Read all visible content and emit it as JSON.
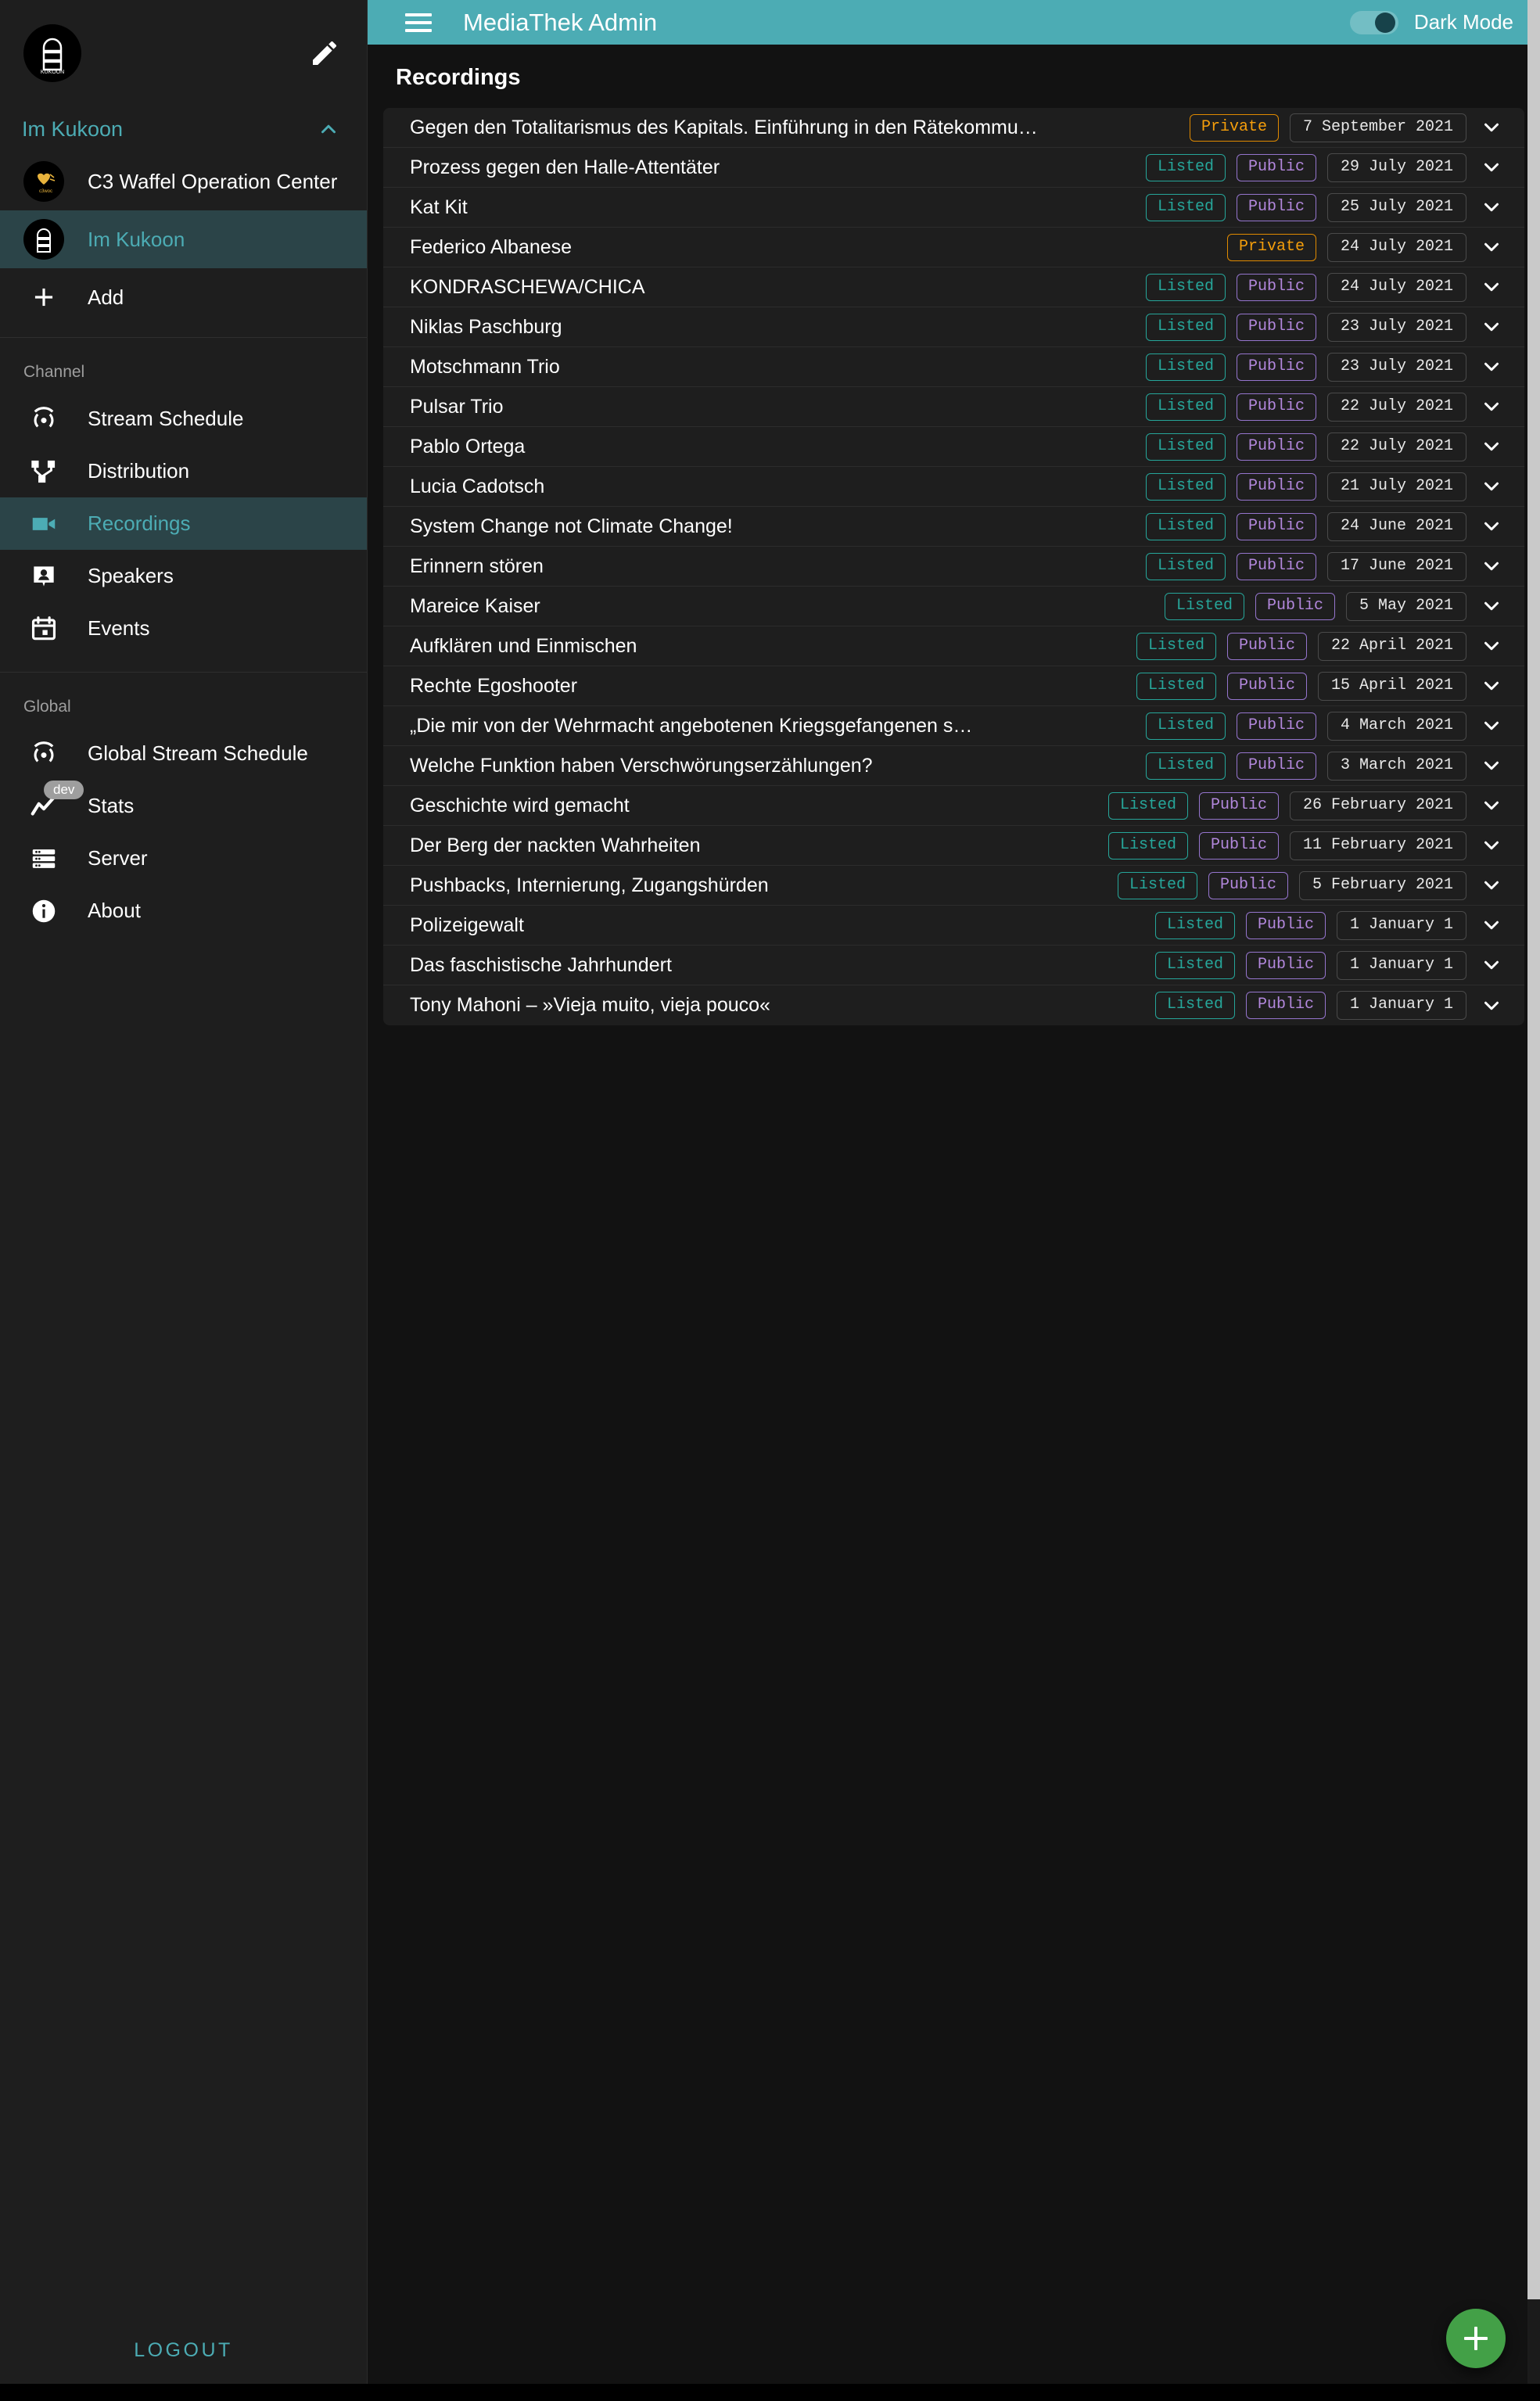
{
  "appbar": {
    "menu_icon": "hamburger-menu-icon",
    "title": "MediaThek Admin",
    "dark_mode_label": "Dark Mode",
    "dark_mode_on": true,
    "accent_color": "#4cacb4"
  },
  "sidebar": {
    "brand": {
      "logo_alt": "Im Kukoon logo",
      "edit_icon": "pencil-icon"
    },
    "workspace": {
      "name": "Im Kukoon",
      "collapse_icon": "chevron-up-icon"
    },
    "workspaces": [
      {
        "label": "C3 Waffel Operation Center",
        "avatar": "c3woc-waffle-heart-icon",
        "active": false
      },
      {
        "label": "Im Kukoon",
        "avatar": "kukoon-logo-icon",
        "active": true
      }
    ],
    "add": {
      "label": "Add",
      "icon": "plus-icon"
    },
    "sections": [
      {
        "label": "Channel",
        "items": [
          {
            "label": "Stream Schedule",
            "icon": "broadcast-icon",
            "active": false,
            "badge": ""
          },
          {
            "label": "Distribution",
            "icon": "distribution-fork-icon",
            "active": false,
            "badge": ""
          },
          {
            "label": "Recordings",
            "icon": "video-camera-icon",
            "active": true,
            "badge": ""
          },
          {
            "label": "Speakers",
            "icon": "speaker-person-icon",
            "active": false,
            "badge": ""
          },
          {
            "label": "Events",
            "icon": "calendar-icon",
            "active": false,
            "badge": ""
          }
        ]
      },
      {
        "label": "Global",
        "items": [
          {
            "label": "Global Stream Schedule",
            "icon": "broadcast-icon",
            "active": false,
            "badge": ""
          },
          {
            "label": "Stats",
            "icon": "line-chart-icon",
            "active": false,
            "badge": "dev"
          },
          {
            "label": "Server",
            "icon": "server-rack-icon",
            "active": false,
            "badge": ""
          },
          {
            "label": "About",
            "icon": "info-icon",
            "active": false,
            "badge": ""
          }
        ]
      }
    ],
    "logout_label": "LOGOUT"
  },
  "main": {
    "page_title": "Recordings",
    "add_recording_icon": "plus-icon",
    "expand_icon": "chevron-down-icon",
    "recordings": [
      {
        "title": "Gegen den Totalitarismus des Kapitals. Einführung in den Rätekommu…",
        "badges": [
          "Private"
        ],
        "date": "7 September 2021"
      },
      {
        "title": "Prozess gegen den Halle-Attentäter",
        "badges": [
          "Listed",
          "Public"
        ],
        "date": "29 July 2021"
      },
      {
        "title": "Kat Kit",
        "badges": [
          "Listed",
          "Public"
        ],
        "date": "25 July 2021"
      },
      {
        "title": "Federico Albanese",
        "badges": [
          "Private"
        ],
        "date": "24 July 2021"
      },
      {
        "title": "KONDRASCHEWA/CHICA",
        "badges": [
          "Listed",
          "Public"
        ],
        "date": "24 July 2021"
      },
      {
        "title": "Niklas Paschburg",
        "badges": [
          "Listed",
          "Public"
        ],
        "date": "23 July 2021"
      },
      {
        "title": "Motschmann Trio",
        "badges": [
          "Listed",
          "Public"
        ],
        "date": "23 July 2021"
      },
      {
        "title": "Pulsar Trio",
        "badges": [
          "Listed",
          "Public"
        ],
        "date": "22 July 2021"
      },
      {
        "title": "Pablo Ortega",
        "badges": [
          "Listed",
          "Public"
        ],
        "date": "22 July 2021"
      },
      {
        "title": "Lucia Cadotsch",
        "badges": [
          "Listed",
          "Public"
        ],
        "date": "21 July 2021"
      },
      {
        "title": "System Change not Climate Change!",
        "badges": [
          "Listed",
          "Public"
        ],
        "date": "24 June 2021"
      },
      {
        "title": "Erinnern stören",
        "badges": [
          "Listed",
          "Public"
        ],
        "date": "17 June 2021"
      },
      {
        "title": "Mareice Kaiser",
        "badges": [
          "Listed",
          "Public"
        ],
        "date": "5 May 2021"
      },
      {
        "title": "Aufklären und Einmischen",
        "badges": [
          "Listed",
          "Public"
        ],
        "date": "22 April 2021"
      },
      {
        "title": "Rechte Egoshooter",
        "badges": [
          "Listed",
          "Public"
        ],
        "date": "15 April 2021"
      },
      {
        "title": "„Die mir von der Wehrmacht angebotenen Kriegsgefangenen s…",
        "badges": [
          "Listed",
          "Public"
        ],
        "date": "4 March 2021"
      },
      {
        "title": "Welche Funktion haben Verschwörungserzählungen?",
        "badges": [
          "Listed",
          "Public"
        ],
        "date": "3 March 2021"
      },
      {
        "title": "Geschichte wird gemacht",
        "badges": [
          "Listed",
          "Public"
        ],
        "date": "26 February 2021"
      },
      {
        "title": "Der Berg der nackten Wahrheiten",
        "badges": [
          "Listed",
          "Public"
        ],
        "date": "11 February 2021"
      },
      {
        "title": "Pushbacks, Internierung, Zugangshürden",
        "badges": [
          "Listed",
          "Public"
        ],
        "date": "5 February 2021"
      },
      {
        "title": "Polizeigewalt",
        "badges": [
          "Listed",
          "Public"
        ],
        "date": "1 January 1"
      },
      {
        "title": "Das faschistische Jahrhundert",
        "badges": [
          "Listed",
          "Public"
        ],
        "date": "1 January 1"
      },
      {
        "title": "Tony Mahoni – »Vieja muito, vieja pouco«",
        "badges": [
          "Listed",
          "Public"
        ],
        "date": "1 January 1"
      }
    ]
  },
  "colors": {
    "accent": "#4cacb4",
    "listed": "#26a69a",
    "public": "#9575cd",
    "private": "#e08a00",
    "fab": "#43a047",
    "surface": "#1e1e1e",
    "background": "#121212"
  }
}
